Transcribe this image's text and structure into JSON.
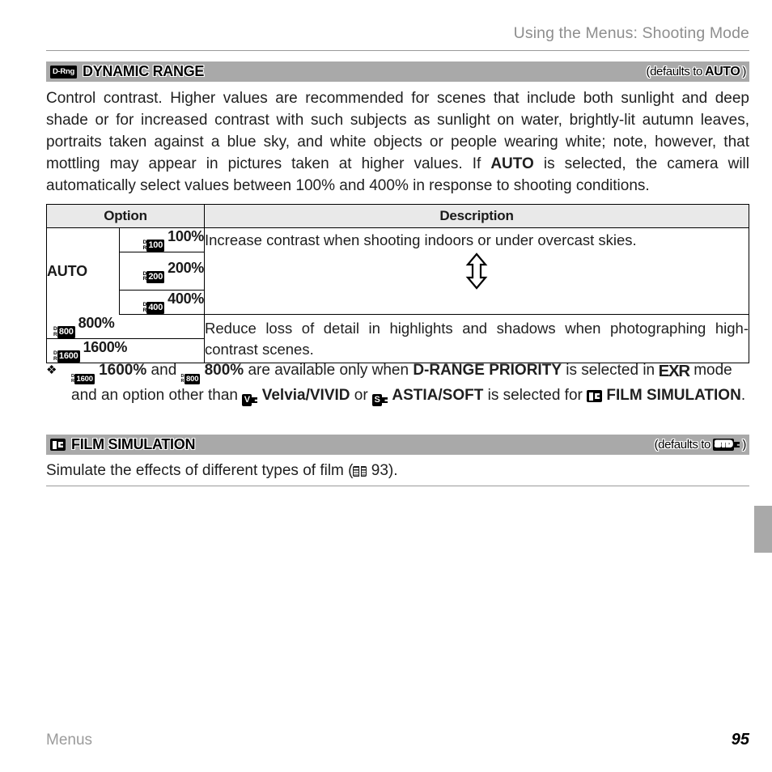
{
  "running_head": "Using the Menus: Shooting Mode",
  "sections": [
    {
      "icon_name": "d-range-icon",
      "icon_text": "D-Rng",
      "title": "DYNAMIC RANGE",
      "default_prefix": "(defaults to ",
      "default_value": "AUTO",
      "default_suffix": ")",
      "body": [
        "Control contrast. Higher values are recommended for scenes that include both sunlight and deep shade or for increased contrast with such subjects as sunlight on water, brightly-lit autumn leaves, portraits taken against a blue sky, and white objects or people wearing white; note, however, that mottling may appear in pictures taken at higher values. If ",
        "AUTO",
        " is selected, the camera will automatically select values between 100% and 400% in response to shooting conditions."
      ]
    },
    {
      "icon_name": "film-simulation-icon",
      "title": "FILM SIMULATION",
      "default_prefix": "(defaults to ",
      "default_icon": "STD",
      "default_suffix": ")",
      "body_prefix": "Simulate the effects of different types of film (",
      "body_page": "93",
      "body_suffix": ")."
    }
  ],
  "table": {
    "headers": [
      "Option",
      "Description"
    ],
    "group_label": "AUTO",
    "auto_rows": [
      {
        "icon_letters": [
          "D",
          "R"
        ],
        "icon_value": "100",
        "label": "100%"
      },
      {
        "icon_letters": [
          "D",
          "R"
        ],
        "icon_value": "200",
        "label": "200%"
      },
      {
        "icon_letters": [
          "D",
          "R"
        ],
        "icon_value": "400",
        "label": "400%"
      }
    ],
    "auto_description": "Increase contrast when shooting indoors or under overcast skies.",
    "arrow_symbol": "⇕",
    "high_rows": [
      {
        "icon_letters": [
          "D",
          "R"
        ],
        "icon_value": "800",
        "label": "800%"
      },
      {
        "icon_letters": [
          "D",
          "R"
        ],
        "icon_value": "1600",
        "label": "1600%"
      }
    ],
    "high_description": "Reduce loss of detail in highlights and shadows when photographing high-contrast scenes."
  },
  "note": {
    "bullet": "❖",
    "icon1_value": "1600",
    "text1": " 1600%",
    "text2": " and ",
    "icon2_value": "800",
    "text3": " 800%",
    "text4": " are available only when ",
    "bold1": "D-RANGE PRIORITY",
    "text5": " is selected in ",
    "exr": "EXR",
    "text6": " mode and an option other than ",
    "velvia_icon": "V",
    "bold2": "Velvia/VIVID",
    "text7": " or ",
    "astia_icon": "S",
    "bold3": "ASTIA/SOFT",
    "text8": " is selected for ",
    "bold4": "FILM SIMULATION",
    "text9": "."
  },
  "footer": {
    "label": "Menus",
    "page": "95"
  }
}
